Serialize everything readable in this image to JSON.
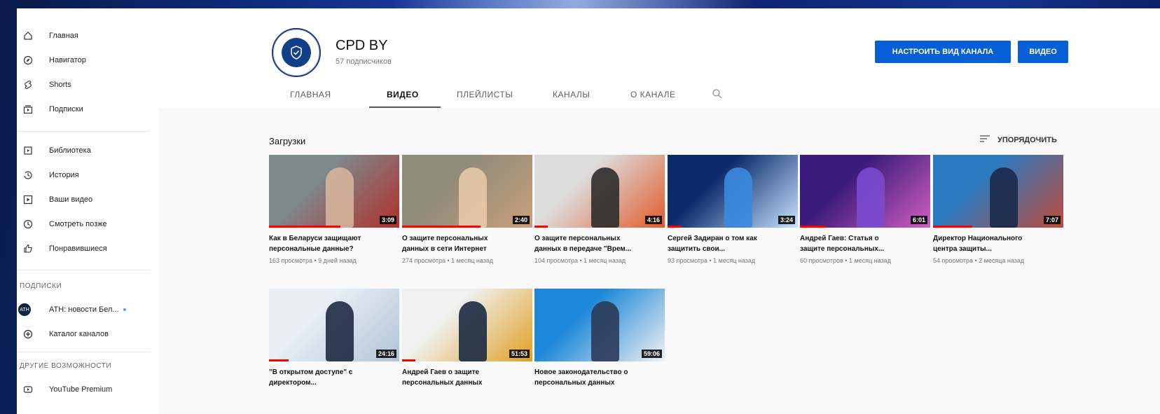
{
  "sidebar": {
    "items": [
      {
        "label": "Главная",
        "icon": "home-icon"
      },
      {
        "label": "Навигатор",
        "icon": "compass-icon"
      },
      {
        "label": "Shorts",
        "icon": "shorts-icon"
      },
      {
        "label": "Подписки",
        "icon": "subscriptions-icon"
      }
    ],
    "library": [
      {
        "label": "Библиотека",
        "icon": "library-icon"
      },
      {
        "label": "История",
        "icon": "history-icon"
      },
      {
        "label": "Ваши видео",
        "icon": "your-videos-icon"
      },
      {
        "label": "Смотреть позже",
        "icon": "watch-later-icon"
      },
      {
        "label": "Понравившиеся",
        "icon": "thumbs-up-icon"
      }
    ],
    "subs_heading": "ПОДПИСКИ",
    "subs": [
      {
        "label": "АТН: новости Бел...",
        "avatar": "ATH"
      },
      {
        "label": "Каталог каналов",
        "icon": "plus-circle-icon"
      }
    ],
    "more_heading": "ДРУГИЕ ВОЗМОЖНОСТИ",
    "more": [
      {
        "label": "YouTube Premium",
        "icon": "youtube-icon"
      }
    ]
  },
  "channel": {
    "name": "CPD BY",
    "subscribers": "57 подписчиков",
    "customize_button": "НАСТРОИТЬ ВИД КАНАЛА",
    "video_button": "ВИДЕО"
  },
  "tabs": [
    {
      "label": "ГЛАВНАЯ",
      "active": false
    },
    {
      "label": "ВИДЕО",
      "active": true
    },
    {
      "label": "ПЛЕЙЛИСТЫ",
      "active": false
    },
    {
      "label": "КАНАЛЫ",
      "active": false
    },
    {
      "label": "О КАНАЛЕ",
      "active": false
    }
  ],
  "section": {
    "title": "Загрузки",
    "sort_label": "УПОРЯДОЧИТЬ"
  },
  "videos": [
    {
      "title1": "Как в Беларуси защищают",
      "title2": "персональные данные?",
      "meta": "163 просмотра • 9 дней назад",
      "duration": "3:09",
      "progress": 0.55,
      "thumb": [
        "#7e8a8e",
        "#d6b49a",
        "#b0302a"
      ]
    },
    {
      "title1": "О защите персональных",
      "title2": "данных в сети Интернет",
      "meta": "274 просмотра • 1 месяц назад",
      "duration": "2:40",
      "progress": 0.6,
      "thumb": [
        "#8f8b7a",
        "#e8c9a8",
        "#c9a07a"
      ]
    },
    {
      "title1": "О защите персональных",
      "title2": "данных в передаче \"Врем...",
      "meta": "104 просмотра • 1 месяц назад",
      "duration": "4:16",
      "progress": 0.1,
      "thumb": [
        "#dcdcdc",
        "#2c2c2c",
        "#e05a2a"
      ]
    },
    {
      "title1": "Сергей Задиран о том как",
      "title2": "защитить свои...",
      "meta": "93 просмотра • 1 месяц назад",
      "duration": "3:24",
      "progress": 0.1,
      "thumb": [
        "#0a2a6a",
        "#3a8ae0",
        "#c9e4ff"
      ]
    },
    {
      "title1": "Андрей Гаев: Статья о",
      "title2": "защите персональных...",
      "meta": "60 просмотров • 1 месяц назад",
      "duration": "6:01",
      "progress": 0.2,
      "thumb": [
        "#3a1a7a",
        "#7a4ad0",
        "#d060c0"
      ]
    },
    {
      "title1": "Директор Национального",
      "title2": "центра защиты...",
      "meta": "54 просмотра • 2 месяца назад",
      "duration": "7:07",
      "progress": 0.3,
      "thumb": [
        "#2a7ac0",
        "#1a2a4a",
        "#c04a3a"
      ]
    },
    {
      "title1": "\"В открытом доступе\" с",
      "title2": "директором...",
      "meta": "",
      "duration": "24:16",
      "progress": 0.15,
      "thumb": [
        "#e8eef4",
        "#1e2a44",
        "#b0c4d8"
      ]
    },
    {
      "title1": "Андрей Гаев о защите",
      "title2": "персональных данных",
      "meta": "",
      "duration": "51:53",
      "progress": 0.1,
      "thumb": [
        "#f0f0f0",
        "#1a2a44",
        "#e0a020"
      ]
    },
    {
      "title1": "Новое законодательство о",
      "title2": "персональных данных",
      "meta": "",
      "duration": "59:06",
      "progress": 0.0,
      "thumb": [
        "#1e88d8",
        "#2a3a5a",
        "#f2f2f2"
      ]
    }
  ]
}
